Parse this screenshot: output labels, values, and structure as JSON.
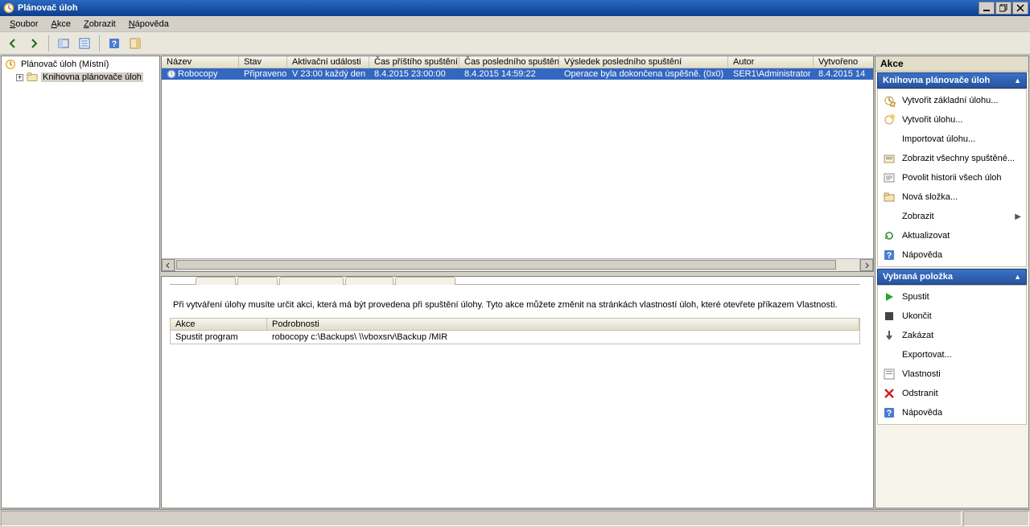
{
  "window": {
    "title": "Plánovač úloh"
  },
  "menu": {
    "file": "Soubor",
    "action": "Akce",
    "view": "Zobrazit",
    "help": "Nápověda"
  },
  "tree": {
    "root": "Plánovač úloh (Místní)",
    "library": "Knihovna plánovače úloh"
  },
  "grid": {
    "columns": {
      "name": "Název",
      "state": "Stav",
      "triggers": "Aktivační události",
      "next_run": "Čas příštího spuštění",
      "last_run": "Čas posledního spuštění",
      "last_result": "Výsledek posledního spuštění",
      "author": "Autor",
      "created": "Vytvořeno"
    },
    "rows": [
      {
        "name": "Robocopy",
        "state": "Připraveno",
        "triggers": "V 23:00 každý den",
        "next_run": "8.4.2015 23:00:00",
        "last_run": "8.4.2015 14:59:22",
        "last_result": "Operace byla dokončena úspěšně. (0x0)",
        "author": "SER1\\Administrator",
        "created": "8.4.2015 14"
      }
    ]
  },
  "detail": {
    "description": "Při vytváření úlohy musíte určit akci, která má být provedena při spuštění úlohy. Tyto akce můžete změnit na stránkách vlastností úloh, které otevřete příkazem Vlastnosti.",
    "columns": {
      "action": "Akce",
      "details": "Podrobnosti"
    },
    "rows": [
      {
        "action": "Spustit program",
        "details": "robocopy c:\\Backups\\ \\\\vboxsrv\\Backup /MIR"
      }
    ]
  },
  "actions": {
    "title": "Akce",
    "group_library": "Knihovna plánovače úloh",
    "library_items": {
      "create_basic": "Vytvořit základní úlohu...",
      "create_task": "Vytvořit úlohu...",
      "import_task": "Importovat úlohu...",
      "show_running": "Zobrazit všechny spuštěné...",
      "enable_history": "Povolit historii všech úloh",
      "new_folder": "Nová složka...",
      "view": "Zobrazit",
      "refresh": "Aktualizovat",
      "help": "Nápověda"
    },
    "group_selected": "Vybraná položka",
    "selected_items": {
      "run": "Spustit",
      "end": "Ukončit",
      "disable": "Zakázat",
      "export": "Exportovat...",
      "properties": "Vlastnosti",
      "delete": "Odstranit",
      "help": "Nápověda"
    }
  }
}
